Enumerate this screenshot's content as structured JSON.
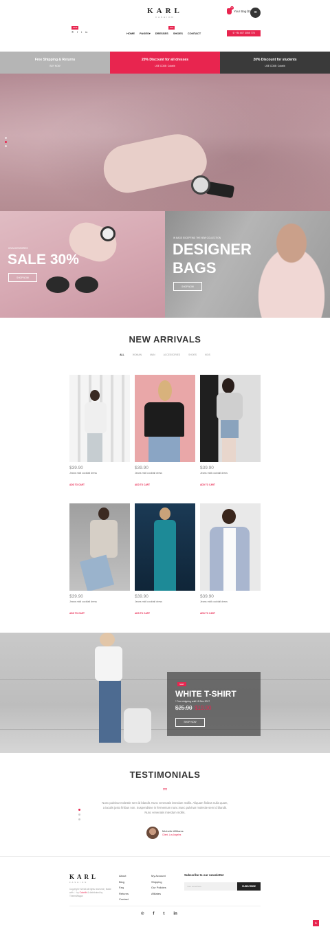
{
  "header": {
    "logo": "KARL",
    "logo_sub": "FASHION",
    "bag_label": "Your Bag $20",
    "bag_count": "2",
    "menu_icon": "hamburger-icon",
    "social": [
      "pinterest-icon",
      "facebook-icon",
      "twitter-icon",
      "linkedin-icon"
    ],
    "sale_badge": "SALE",
    "hot_badge": "HOT",
    "nav": [
      "HOME",
      "PAGES",
      "DRESSES",
      "SHOES",
      "CONTACT"
    ],
    "phone": "+34 607 3055 778"
  },
  "promo_strip": [
    {
      "title": "Free Shipping & Returns",
      "sub": "BUY NOW",
      "color": "#b5b5b5"
    },
    {
      "title": "20% Discount for all dresses",
      "sub": "USE CODE: Colorlib",
      "color": "#e8254f"
    },
    {
      "title": "20% Discount for students",
      "sub": "USE CODE: Colorlib",
      "color": "#3a3a3a"
    }
  ],
  "banners": {
    "left": {
      "sub": "ON ACCESSORIES",
      "title": "SALE 30%",
      "button": "SHOP NOW"
    },
    "right": {
      "sub": "IN BAGS EXCEPTING THE NEW COLLECTION",
      "title_line1": "DESIGNER",
      "title_line2": "BAGS",
      "button": "SHOP NOW"
    }
  },
  "arrivals": {
    "title": "NEW ARRIVALS",
    "filters": [
      "ALL",
      "WOMAN",
      "MAN",
      "ACCESSORIES",
      "SHOES",
      "KIDS"
    ],
    "products": [
      {
        "price": "$39.90",
        "name": "Jeans midi cocktail dress",
        "cta": "ADD TO CART"
      },
      {
        "price": "$39.90",
        "name": "Jeans midi cocktail dress",
        "cta": "ADD TO CART"
      },
      {
        "price": "$39.90",
        "name": "Jeans midi cocktail dress",
        "cta": "ADD TO CART"
      },
      {
        "price": "$39.90",
        "name": "Jeans midi cocktail dress",
        "cta": "ADD TO CART"
      },
      {
        "price": "$39.90",
        "name": "Jeans midi cocktail dress",
        "cta": "ADD TO CART"
      },
      {
        "price": "$39.90",
        "name": "Jeans midi cocktail dress",
        "cta": "ADD TO CART"
      }
    ]
  },
  "promo": {
    "tag": "NEW",
    "title": "WHITE T-SHIRT",
    "note": "* Free shipping until 15 Dec 2017",
    "old_price": "$25.90",
    "new_price": "$19.90",
    "button": "SHOP NOW"
  },
  "testimonials": {
    "title": "TESTIMONIALS",
    "quote": "Nunc pulvinar molestie sem id blandit. Nunc venenatis interdum mollis. Aliquam finibus nulla quam, a iaculis justo finibus non. Suspendisse in fermentum nunc.Nunc pulvinar molestie sem id blandit. Nunc venenatis interdum mollis.",
    "author": "Michelle Williams",
    "location": "Client, Los Angeles"
  },
  "footer": {
    "logo": "KARL",
    "logo_sub": "FASHION",
    "copyright": "Copyright ©2018 All rights reserved | Made with ♡ by",
    "brand": "Colorlib",
    "distributed": "& distributed by ThemeWagon",
    "col1": [
      "About",
      "Blog",
      "Faq",
      "Returns",
      "Contact"
    ],
    "col2": [
      "My Account",
      "Shipping",
      "Our Policies",
      "Afiliates"
    ],
    "subscribe_title": "Subscribe to our newsletter",
    "subscribe_placeholder": "Your email here",
    "subscribe_button": "SUBSCRIBE",
    "social": [
      "pinterest-icon",
      "facebook-icon",
      "twitter-icon",
      "linkedin-icon"
    ]
  },
  "colors": {
    "accent": "#e8254f",
    "dark": "#3a3a3a",
    "light_gray": "#b5b5b5"
  }
}
